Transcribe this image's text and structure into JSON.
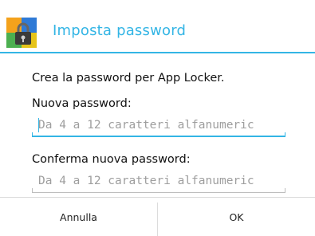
{
  "dialog": {
    "title": "Imposta password",
    "icon": "app-locker-icon",
    "accent_color": "#33b5e5"
  },
  "content": {
    "intro": "Crea la password per App Locker.",
    "new_password_label": "Nuova password:",
    "new_password_placeholder": "Da 4 a 12 caratteri alfanumeric",
    "confirm_password_label": "Conferma nuova password:",
    "confirm_password_placeholder": "Da 4 a 12 caratteri alfanumeric"
  },
  "buttons": {
    "cancel": "Annulla",
    "ok": "OK"
  }
}
